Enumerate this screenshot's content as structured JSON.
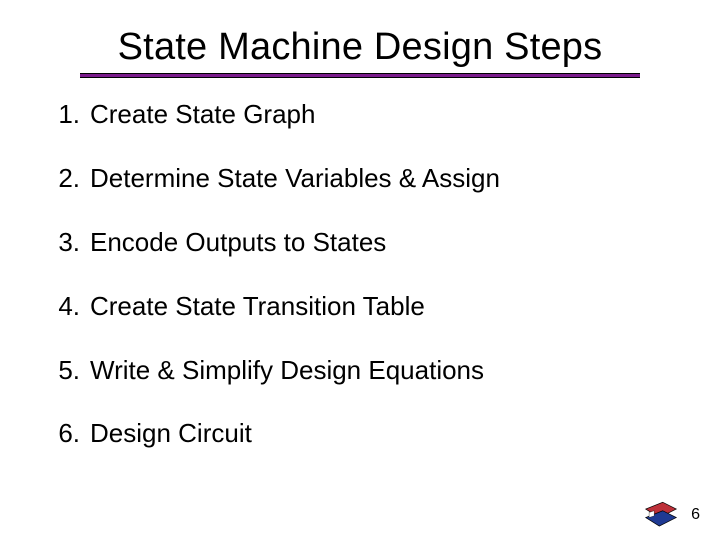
{
  "title": "State Machine Design Steps",
  "steps": [
    {
      "num": "1.",
      "text": "Create State Graph"
    },
    {
      "num": "2.",
      "text": "Determine State Variables & Assign"
    },
    {
      "num": "3.",
      "text": "Encode Outputs to States"
    },
    {
      "num": "4.",
      "text": "Create State Transition Table"
    },
    {
      "num": "5.",
      "text": "Write & Simplify Design Equations"
    },
    {
      "num": "6.",
      "text": "Design Circuit"
    }
  ],
  "page_number": "6",
  "colors": {
    "accent": "#7a1b8b",
    "flag_red": "#bd3039",
    "flag_blue": "#1f3a93"
  }
}
